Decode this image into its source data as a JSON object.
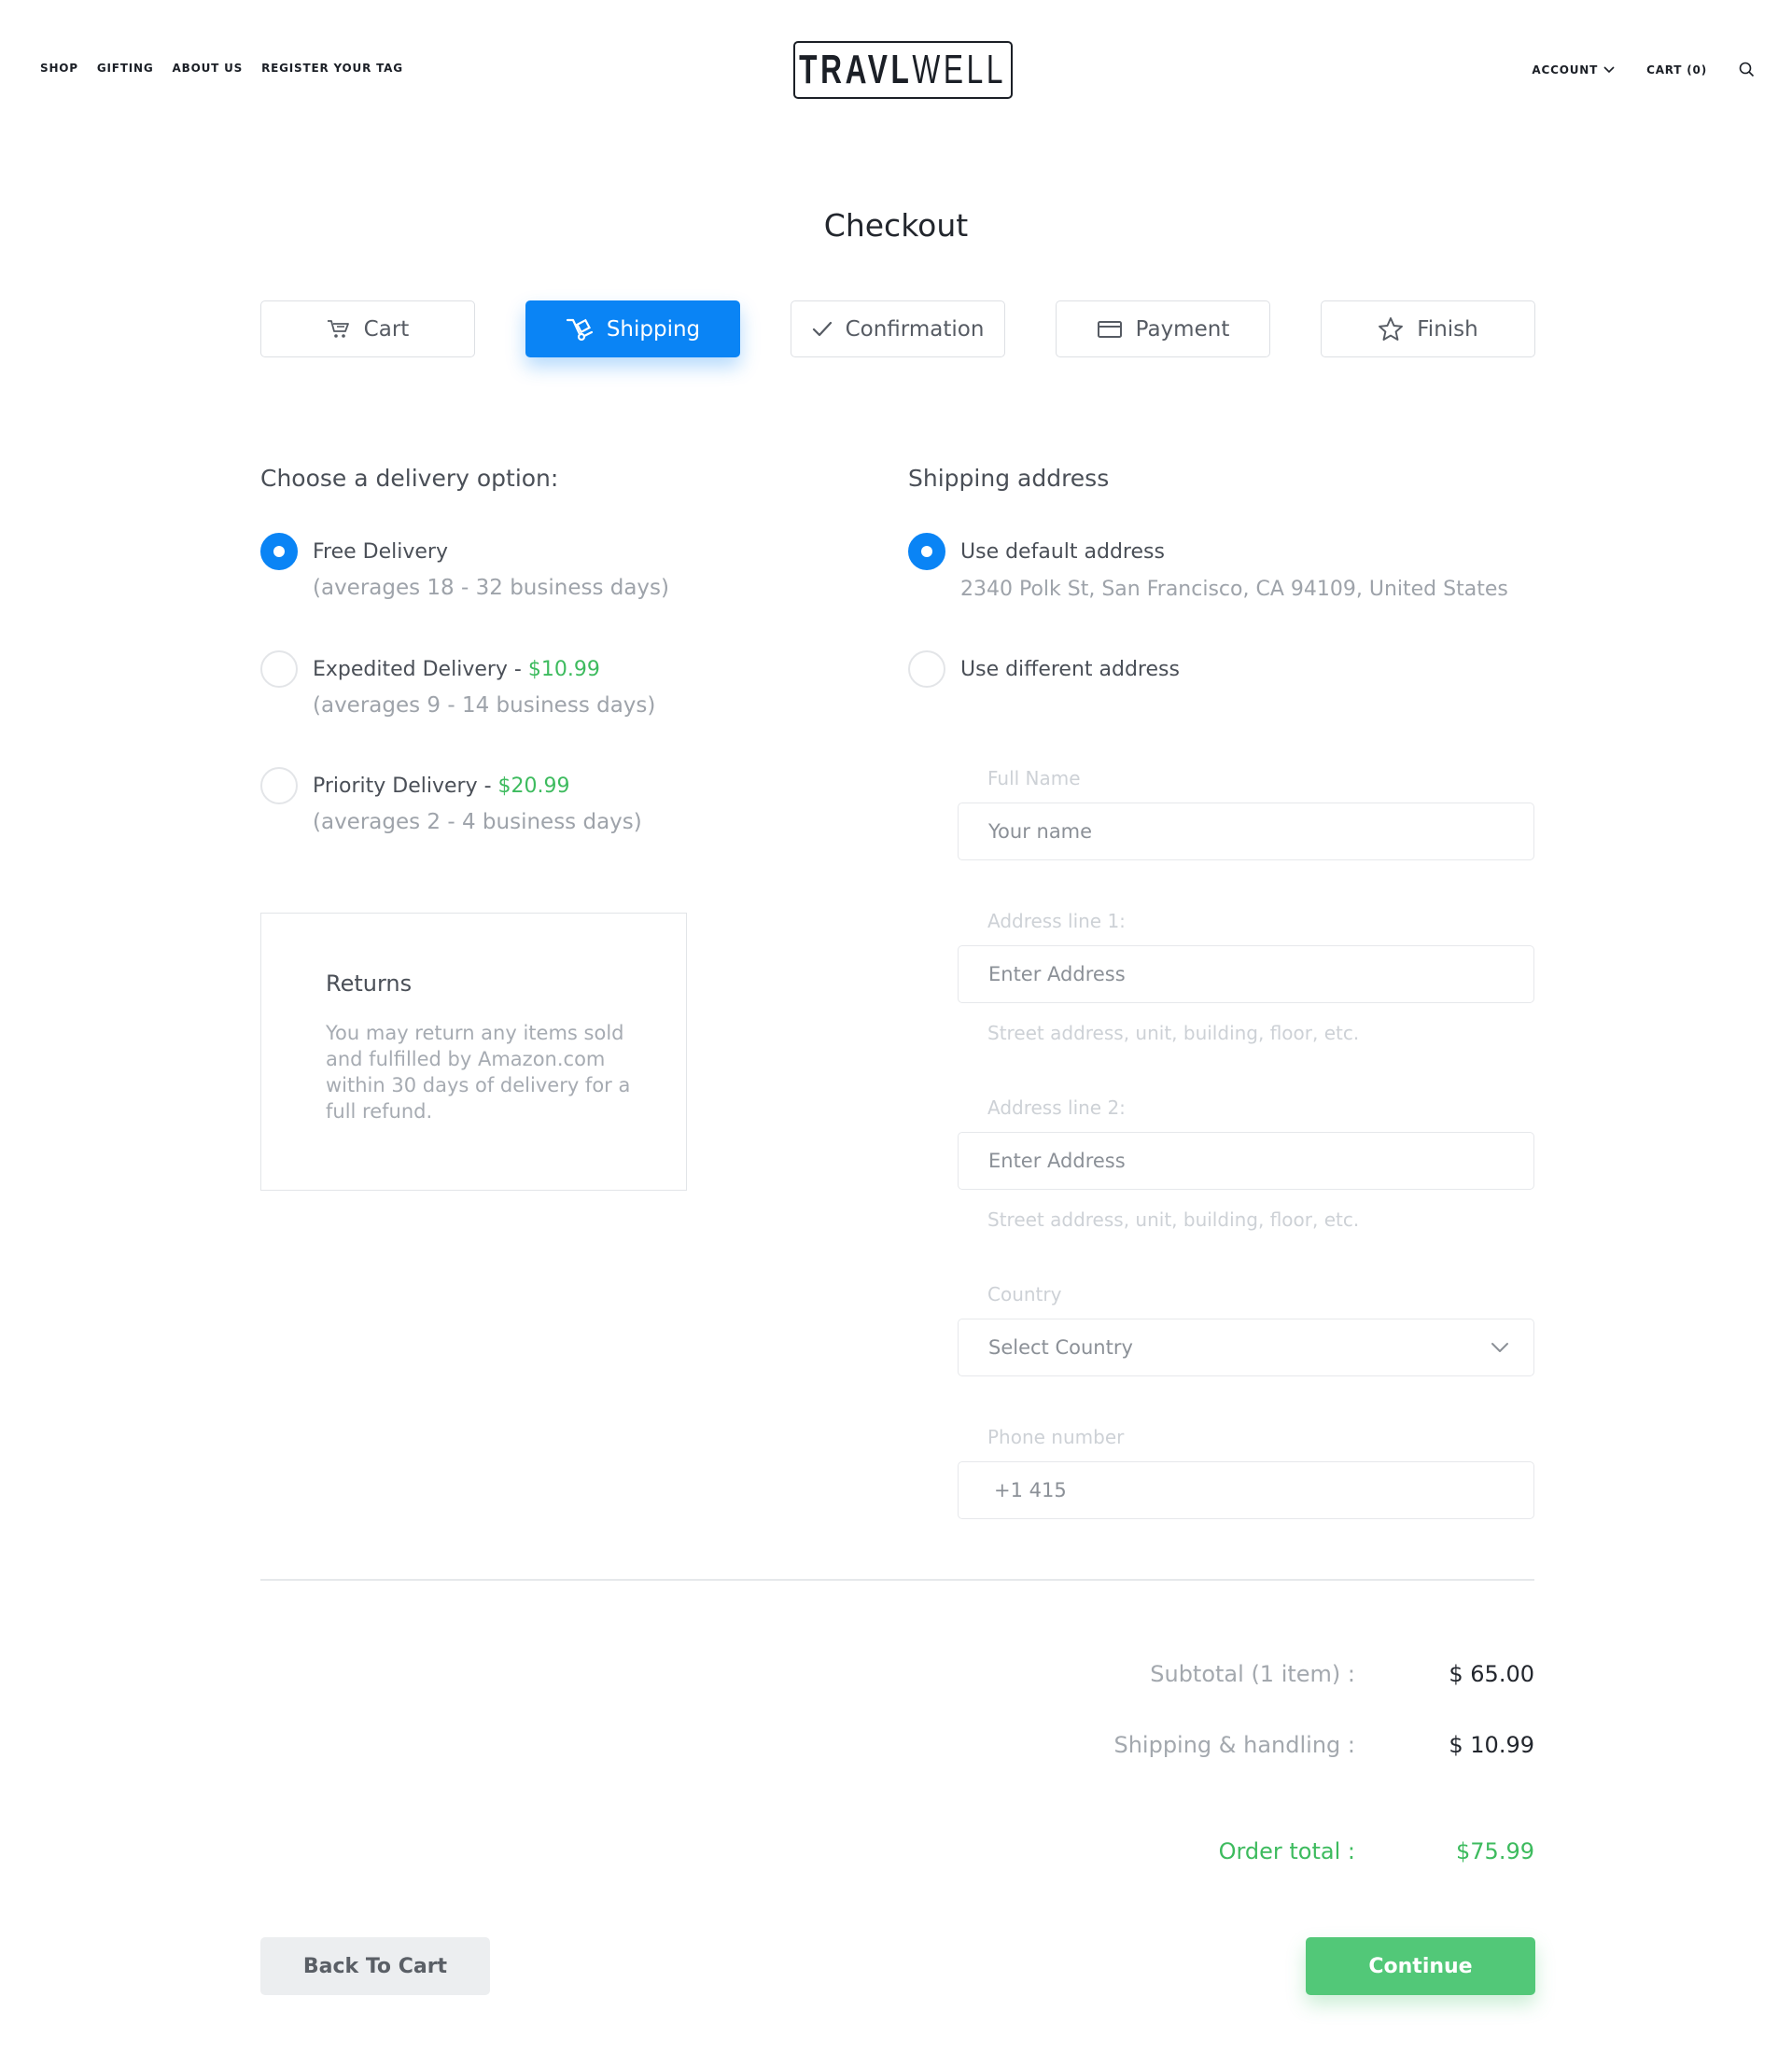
{
  "header": {
    "nav": [
      "SHOP",
      "GIFTING",
      "ABOUT US",
      "REGISTER YOUR TAG"
    ],
    "logo": {
      "part1": "TRAVL",
      "part2": "WELL"
    },
    "account_label": "ACCOUNT",
    "cart_label": "CART (0)"
  },
  "page": {
    "title": "Checkout"
  },
  "steps": [
    {
      "label": "Cart",
      "icon": "cart-icon",
      "active": false
    },
    {
      "label": "Shipping",
      "icon": "hand-truck-icon",
      "active": true
    },
    {
      "label": "Confirmation",
      "icon": "checkmark-icon",
      "active": false
    },
    {
      "label": "Payment",
      "icon": "credit-card-icon",
      "active": false
    },
    {
      "label": "Finish",
      "icon": "star-icon",
      "active": false
    }
  ],
  "delivery": {
    "title": "Choose a delivery option:",
    "options": [
      {
        "label": "Free Delivery",
        "price": "",
        "note": "(averages 18 - 32 business days)",
        "selected": true
      },
      {
        "label": "Expedited Delivery - ",
        "price": "$10.99",
        "note": "(averages 9 - 14 business days)",
        "selected": false
      },
      {
        "label": "Priority Delivery - ",
        "price": "$20.99",
        "note": "(averages 2 - 4 business days)",
        "selected": false
      }
    ]
  },
  "returns": {
    "title": "Returns",
    "text": "You may return any items sold and fulfilled by Amazon.com within 30 days of delivery for a full refund."
  },
  "shipping": {
    "title": "Shipping address",
    "default_label": "Use default address",
    "default_address": "2340 Polk St, San Francisco, CA 94109, United States",
    "different_label": "Use different address",
    "full_name": {
      "label": "Full Name",
      "placeholder": "Your name"
    },
    "address1": {
      "label": "Address line 1:",
      "placeholder": "Enter Address",
      "help": "Street address, unit, building, floor, etc."
    },
    "address2": {
      "label": "Address line 2:",
      "placeholder": "Enter Address",
      "help": "Street address, unit, building, floor, etc."
    },
    "country": {
      "label": "Country",
      "value": "Select Country"
    },
    "phone": {
      "label": "Phone number",
      "value": "+1 415"
    }
  },
  "summary": {
    "subtotal_label": "Subtotal (1 item) :",
    "subtotal_value": "$ 65.00",
    "shipping_label": "Shipping & handling :",
    "shipping_value": "$ 10.99",
    "total_label": "Order total :",
    "total_value": "$75.99"
  },
  "actions": {
    "back_label": "Back To Cart",
    "continue_label": "Continue"
  },
  "colors": {
    "accent": "#0a84f5",
    "success": "#3dbb5e",
    "button_green": "#52c878"
  }
}
